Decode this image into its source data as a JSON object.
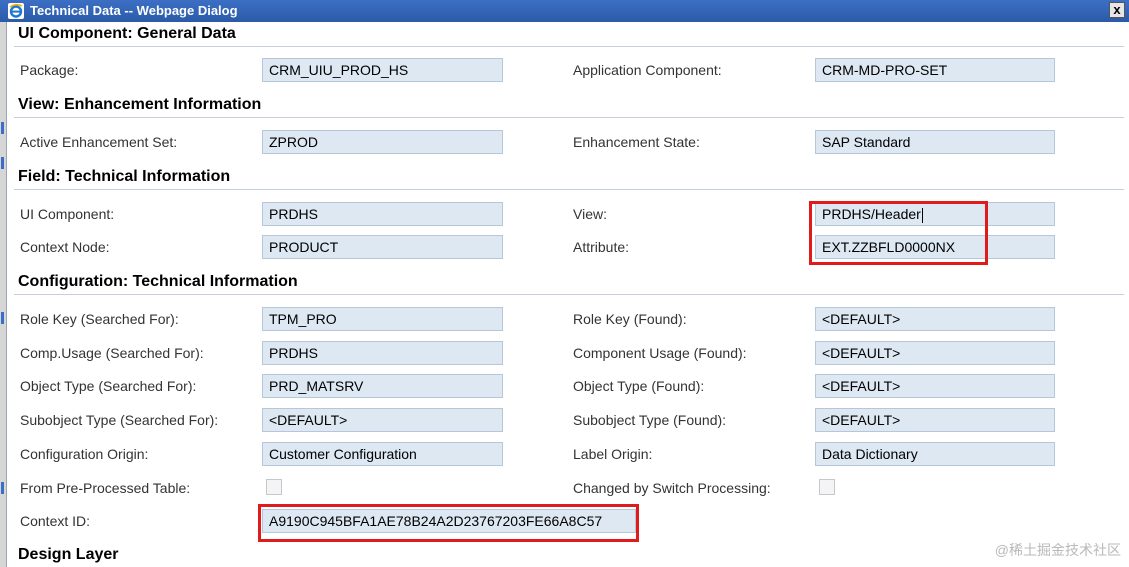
{
  "window": {
    "title": "Technical Data -- Webpage Dialog",
    "close_label": "x"
  },
  "sections": {
    "general": "UI Component: General Data",
    "view": "View: Enhancement Information",
    "field": "Field: Technical Information",
    "config": "Configuration: Technical Information",
    "design": "Design Layer"
  },
  "general": {
    "package_label": "Package:",
    "package_value": "CRM_UIU_PROD_HS",
    "appcomp_label": "Application Component:",
    "appcomp_value": "CRM-MD-PRO-SET"
  },
  "view": {
    "enhset_label": "Active Enhancement Set:",
    "enhset_value": "ZPROD",
    "enhstate_label": "Enhancement State:",
    "enhstate_value": "SAP Standard"
  },
  "field": {
    "uicomp_label": "UI Component:",
    "uicomp_value": "PRDHS",
    "view_label": "View:",
    "view_value": "PRDHS/Header",
    "ctxnode_label": "Context Node:",
    "ctxnode_value": "PRODUCT",
    "attr_label": "Attribute:",
    "attr_value": "EXT.ZZBFLD0000NX"
  },
  "config": {
    "rolekey_s_label": "Role Key (Searched For):",
    "rolekey_s_value": "TPM_PRO",
    "rolekey_f_label": "Role Key (Found):",
    "rolekey_f_value": "<DEFAULT>",
    "compusage_s_label": "Comp.Usage (Searched For):",
    "compusage_s_value": "PRDHS",
    "compusage_f_label": "Component Usage (Found):",
    "compusage_f_value": "<DEFAULT>",
    "objtype_s_label": "Object Type (Searched For):",
    "objtype_s_value": "PRD_MATSRV",
    "objtype_f_label": "Object Type (Found):",
    "objtype_f_value": "<DEFAULT>",
    "subobj_s_label": "Subobject Type (Searched For):",
    "subobj_s_value": "<DEFAULT>",
    "subobj_f_label": "Subobject Type (Found):",
    "subobj_f_value": "<DEFAULT>",
    "cfgorigin_label": "Configuration Origin:",
    "cfgorigin_value": "Customer Configuration",
    "lblorigin_label": "Label Origin:",
    "lblorigin_value": "Data Dictionary",
    "preproc_label": "From Pre-Processed Table:",
    "switch_label": "Changed by Switch Processing:",
    "ctxid_label": "Context ID:",
    "ctxid_value": "A9190C945BFA1AE78B24A2D23767203FE66A8C57"
  },
  "watermark": "@稀土掘金技术社区",
  "colors": {
    "titlebar": "#2b5aa8",
    "field_bg": "#dde8f3",
    "highlight": "#e01b1b"
  }
}
